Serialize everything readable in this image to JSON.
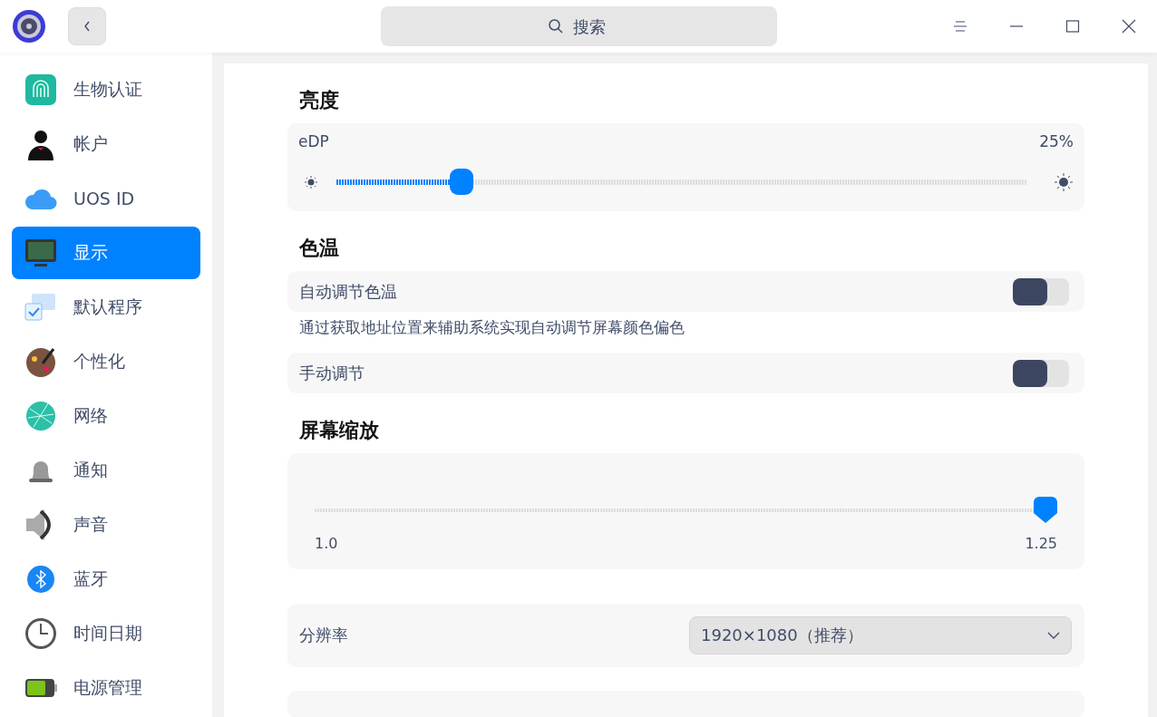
{
  "search": {
    "placeholder": "搜索"
  },
  "sidebar": {
    "items": [
      {
        "label": "生物认证",
        "selected": false
      },
      {
        "label": "帐户",
        "selected": false
      },
      {
        "label": "UOS  ID",
        "selected": false
      },
      {
        "label": "显示",
        "selected": true
      },
      {
        "label": "默认程序",
        "selected": false
      },
      {
        "label": "个性化",
        "selected": false
      },
      {
        "label": "网络",
        "selected": false
      },
      {
        "label": "通知",
        "selected": false
      },
      {
        "label": "声音",
        "selected": false
      },
      {
        "label": "蓝牙",
        "selected": false
      },
      {
        "label": "时间日期",
        "selected": false
      },
      {
        "label": "电源管理",
        "selected": false
      }
    ]
  },
  "brightness": {
    "title": "亮度",
    "monitor": "eDP",
    "reading": "25%",
    "level": 0.17
  },
  "color_temperature": {
    "title": "色温",
    "auto": {
      "label": "自动调节色温",
      "on": false
    },
    "description": "通过获取地址位置来辅助系统实现自动调节屏幕颜色偏色",
    "manual": {
      "label": "手动调节",
      "on": false
    }
  },
  "scaling": {
    "title": "屏幕缩放",
    "level": 1,
    "min_label": "1.0",
    "max_label": "1.25"
  },
  "resolution": {
    "label": "分辨率",
    "value": "1920×1080（推荐）"
  }
}
